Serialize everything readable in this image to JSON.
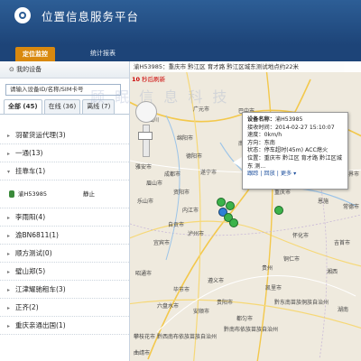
{
  "header": {
    "title": "位置信息服务平台",
    "tabs": [
      {
        "label": "定位监控",
        "active": true
      },
      {
        "label": "统计报表",
        "active": false
      }
    ]
  },
  "sidebar": {
    "heading": "我的设备",
    "search_placeholder": "请输入设备ID/名称/SIM卡号",
    "tabs": [
      {
        "label": "全部 (45)",
        "active": true
      },
      {
        "label": "在线 (36)",
        "active": false
      },
      {
        "label": "离线 (7)",
        "active": false
      }
    ],
    "groups": [
      {
        "label": "羽翟货运代理(3)",
        "expanded": false
      },
      {
        "label": "一通(13)",
        "expanded": false
      },
      {
        "label": "挂靠车(1)",
        "expanded": true
      }
    ],
    "vehicle": {
      "plate": "渝H53985",
      "status": "静止"
    },
    "groups2": [
      {
        "label": "李雨阳(4)"
      },
      {
        "label": "渝BN6811(1)"
      },
      {
        "label": "顺方测试(0)"
      },
      {
        "label": "璧山郑(5)"
      },
      {
        "label": "江津耀驰租车(3)"
      },
      {
        "label": "正齐(2)"
      },
      {
        "label": "重庆亲通出国(1)"
      }
    ]
  },
  "map": {
    "address_bar": "渝H53985：重庆市 黔江区 育才路 黔江区城东测试地点约22米",
    "refresh_seconds": "10",
    "refresh_suffix": "秒后刷新",
    "watermark": "顾 眠 信 息 科 技",
    "cities": [
      "广元市",
      "巴中市",
      "达州市",
      "南充市",
      "绵阳市",
      "德阳市",
      "成都市",
      "遂宁市",
      "广安市",
      "资阳市",
      "内江市",
      "自贡市",
      "宜宾市",
      "泸州市",
      "遵义市",
      "贵阳市",
      "毕节市",
      "六盘水市",
      "安顺市",
      "铜仁市",
      "重庆市",
      "万州区",
      "恩施",
      "张家界市",
      "常德市",
      "怀化市",
      "吉首市",
      "黔东南苗族侗族自治州",
      "黔南布依族苗族自治州",
      "黔西南布依族苗族自治州",
      "凯里市",
      "都匀市",
      "乐山市",
      "眉山市",
      "雅安市",
      "湘西",
      "贵州",
      "湖南",
      "四川",
      "攀枝花市",
      "昭通市",
      "曲靖市"
    ]
  },
  "popup": {
    "device_label": "设备名称：",
    "device_name": "渝H53985",
    "time_label": "接收时间：",
    "time": "2014-02-27 15:10:07",
    "speed_label": "速度：",
    "speed": "0km/h",
    "dir_label": "方向：",
    "dir": "东南",
    "state_label": "状态：",
    "state": "停车超时(45m) ACC熄火",
    "loc_label": "位置：",
    "location": "重庆市 黔江区 育才路 黔江区城东",
    "loc_more": "测...",
    "link_track": "跟踪",
    "link_replay": "回放",
    "link_more": "更多 ▾"
  },
  "colors": {
    "header": "#2d5e96",
    "active_tab": "#d9890f",
    "map_bg": "#efeade",
    "marker_green": "#3cb34a"
  }
}
